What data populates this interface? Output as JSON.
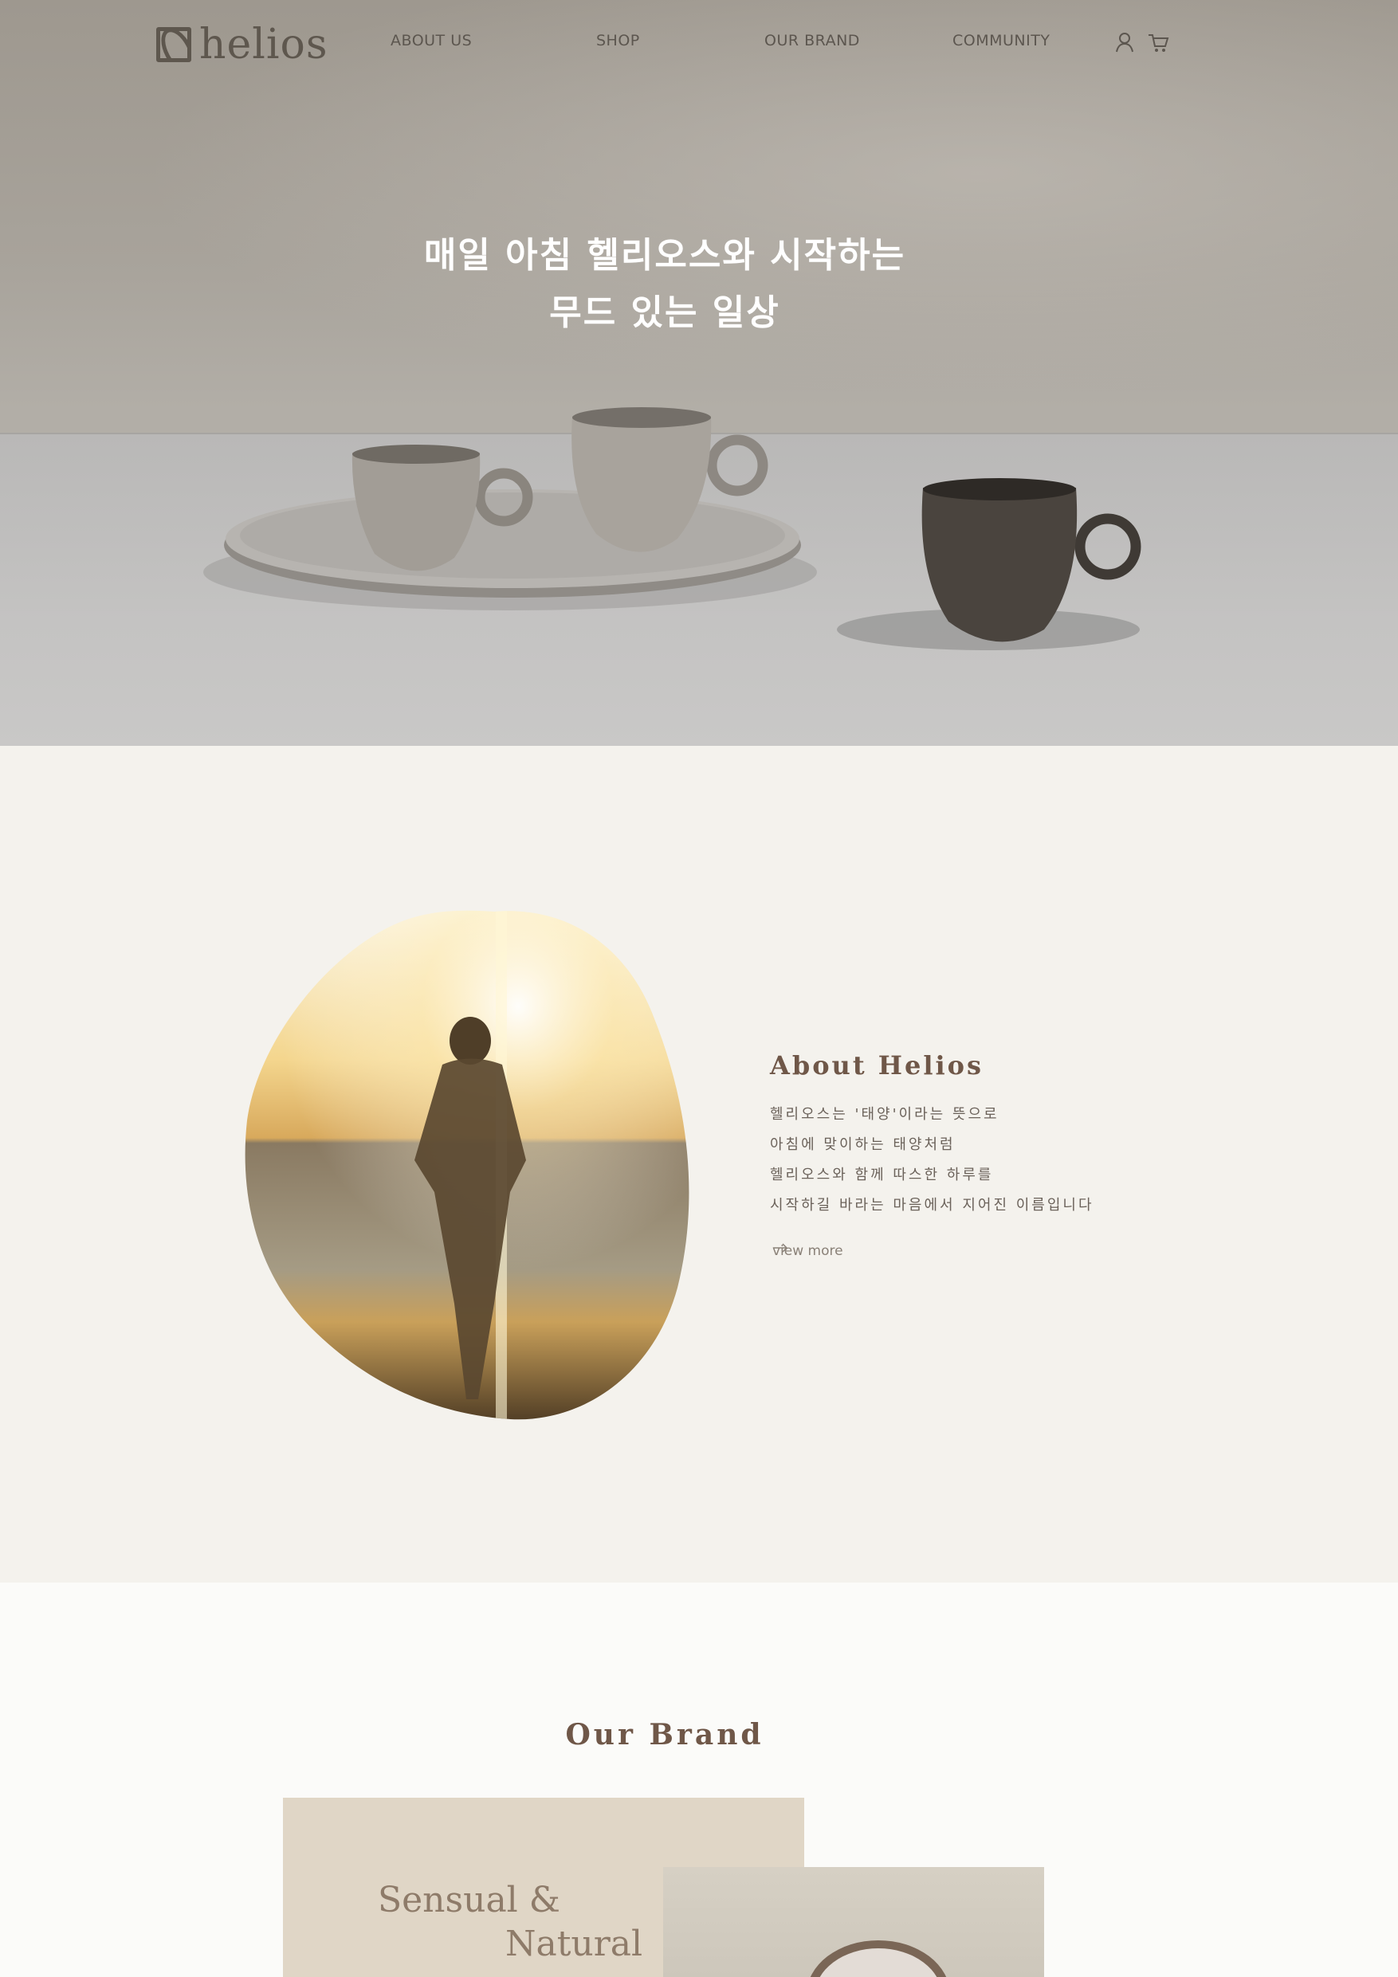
{
  "brand": {
    "logo_text": "helios"
  },
  "nav": {
    "items": [
      {
        "label": "ABOUT US"
      },
      {
        "label": "SHOP"
      },
      {
        "label": "OUR BRAND"
      },
      {
        "label": "COMMUNITY"
      }
    ],
    "icons": [
      "user-icon",
      "cart-icon"
    ]
  },
  "hero": {
    "title_line1": "매일 아침 헬리오스와 시작하는",
    "title_line2": "무드 있는 일상"
  },
  "about": {
    "title": "About Helios",
    "lines": [
      "헬리오스는 '태양'이라는 뜻으로",
      "아침에 맞이하는 태양처럼",
      "헬리오스와 함께 따스한 하루를",
      "시작하길 바라는 마음에서 지어진 이름입니다"
    ],
    "link_label": "view more",
    "link_icon": "arrow-right-icon"
  },
  "our_brand": {
    "title": "Our Brand",
    "phrase_line1": "Sensual &",
    "phrase_line2": "Natural"
  },
  "colors": {
    "accent_brown": "#6f5748",
    "nav_text": "#5c564f",
    "brand_card": "#e0d6c6",
    "about_bg": "#f4f2ed"
  }
}
